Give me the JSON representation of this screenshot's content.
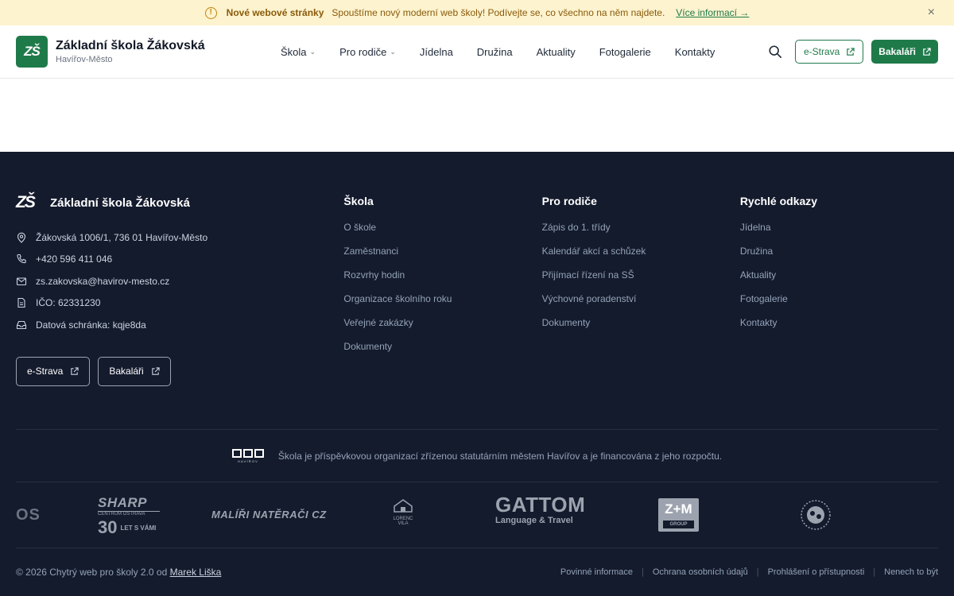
{
  "announcement": {
    "title": "Nové webové stránky",
    "text": "Spouštíme nový moderní web školy! Podívejte se, co všechno na něm najdete.",
    "link": "Více informací →",
    "close": "×"
  },
  "header": {
    "logo_text": "ZŠ",
    "school_name": "Základní škola Žákovská",
    "city": "Havířov-Město",
    "nav": [
      {
        "label": "Škola",
        "dropdown": true
      },
      {
        "label": "Pro rodiče",
        "dropdown": true
      },
      {
        "label": "Jídelna"
      },
      {
        "label": "Družina"
      },
      {
        "label": "Aktuality"
      },
      {
        "label": "Fotogalerie"
      },
      {
        "label": "Kontakty"
      }
    ],
    "estrava_label": "e-Strava",
    "bakalari_label": "Bakaláři"
  },
  "footer": {
    "logo_text": "ZŠ",
    "school_name": "Základní škola Žákovská",
    "address": "Žákovská 1006/1, 736 01 Havířov-Město",
    "phone": "+420 596 411 046",
    "email": "zs.zakovska@havirov-mesto.cz",
    "ico": "IČO: 62331230",
    "data_box": "Datová schránka: kqje8da",
    "estrava_label": "e-Strava",
    "bakalari_label": "Bakaláři",
    "columns": [
      {
        "title": "Škola",
        "links": [
          "O škole",
          "Zaměstnanci",
          "Rozvrhy hodin",
          "Organizace školního roku",
          "Veřejné zakázky",
          "Dokumenty"
        ]
      },
      {
        "title": "Pro rodiče",
        "links": [
          "Zápis do 1. třídy",
          "Kalendář akcí a schůzek",
          "Přijímací řízení na SŠ",
          "Výchovné poradenství",
          "Dokumenty"
        ]
      },
      {
        "title": "Rychlé odkazy",
        "links": [
          "Jídelna",
          "Družina",
          "Aktuality",
          "Fotogalerie",
          "Kontakty"
        ]
      }
    ],
    "city_logo_text": "HAVÍŘOV",
    "funding_text": "Škola je příspěvkovou organizací zřízenou statutárním městem Havířov a je financována z jeho rozpočtu.",
    "sponsors": {
      "s0": "OS",
      "sharp": "SHARP",
      "sharp_sub": "CENTRUM OSTRAVA",
      "sharp_years": "30",
      "sharp_tag": "LET S VÁMI",
      "malir": "MALÍŘI NATĚRAČI CZ",
      "lorenc": "LORENC VILA",
      "gattom": "GATTOM",
      "gattom_sub": "Language & Travel",
      "zm": "Z+M",
      "zm_sub": "GROUP"
    },
    "copyright": "© 2026 Chytrý web pro školy 2.0 od",
    "author": "Marek Liška",
    "legal": [
      "Povinné informace",
      "Ochrana osobních údajů",
      "Prohlášení o přístupnosti",
      "Nenech to být"
    ]
  }
}
